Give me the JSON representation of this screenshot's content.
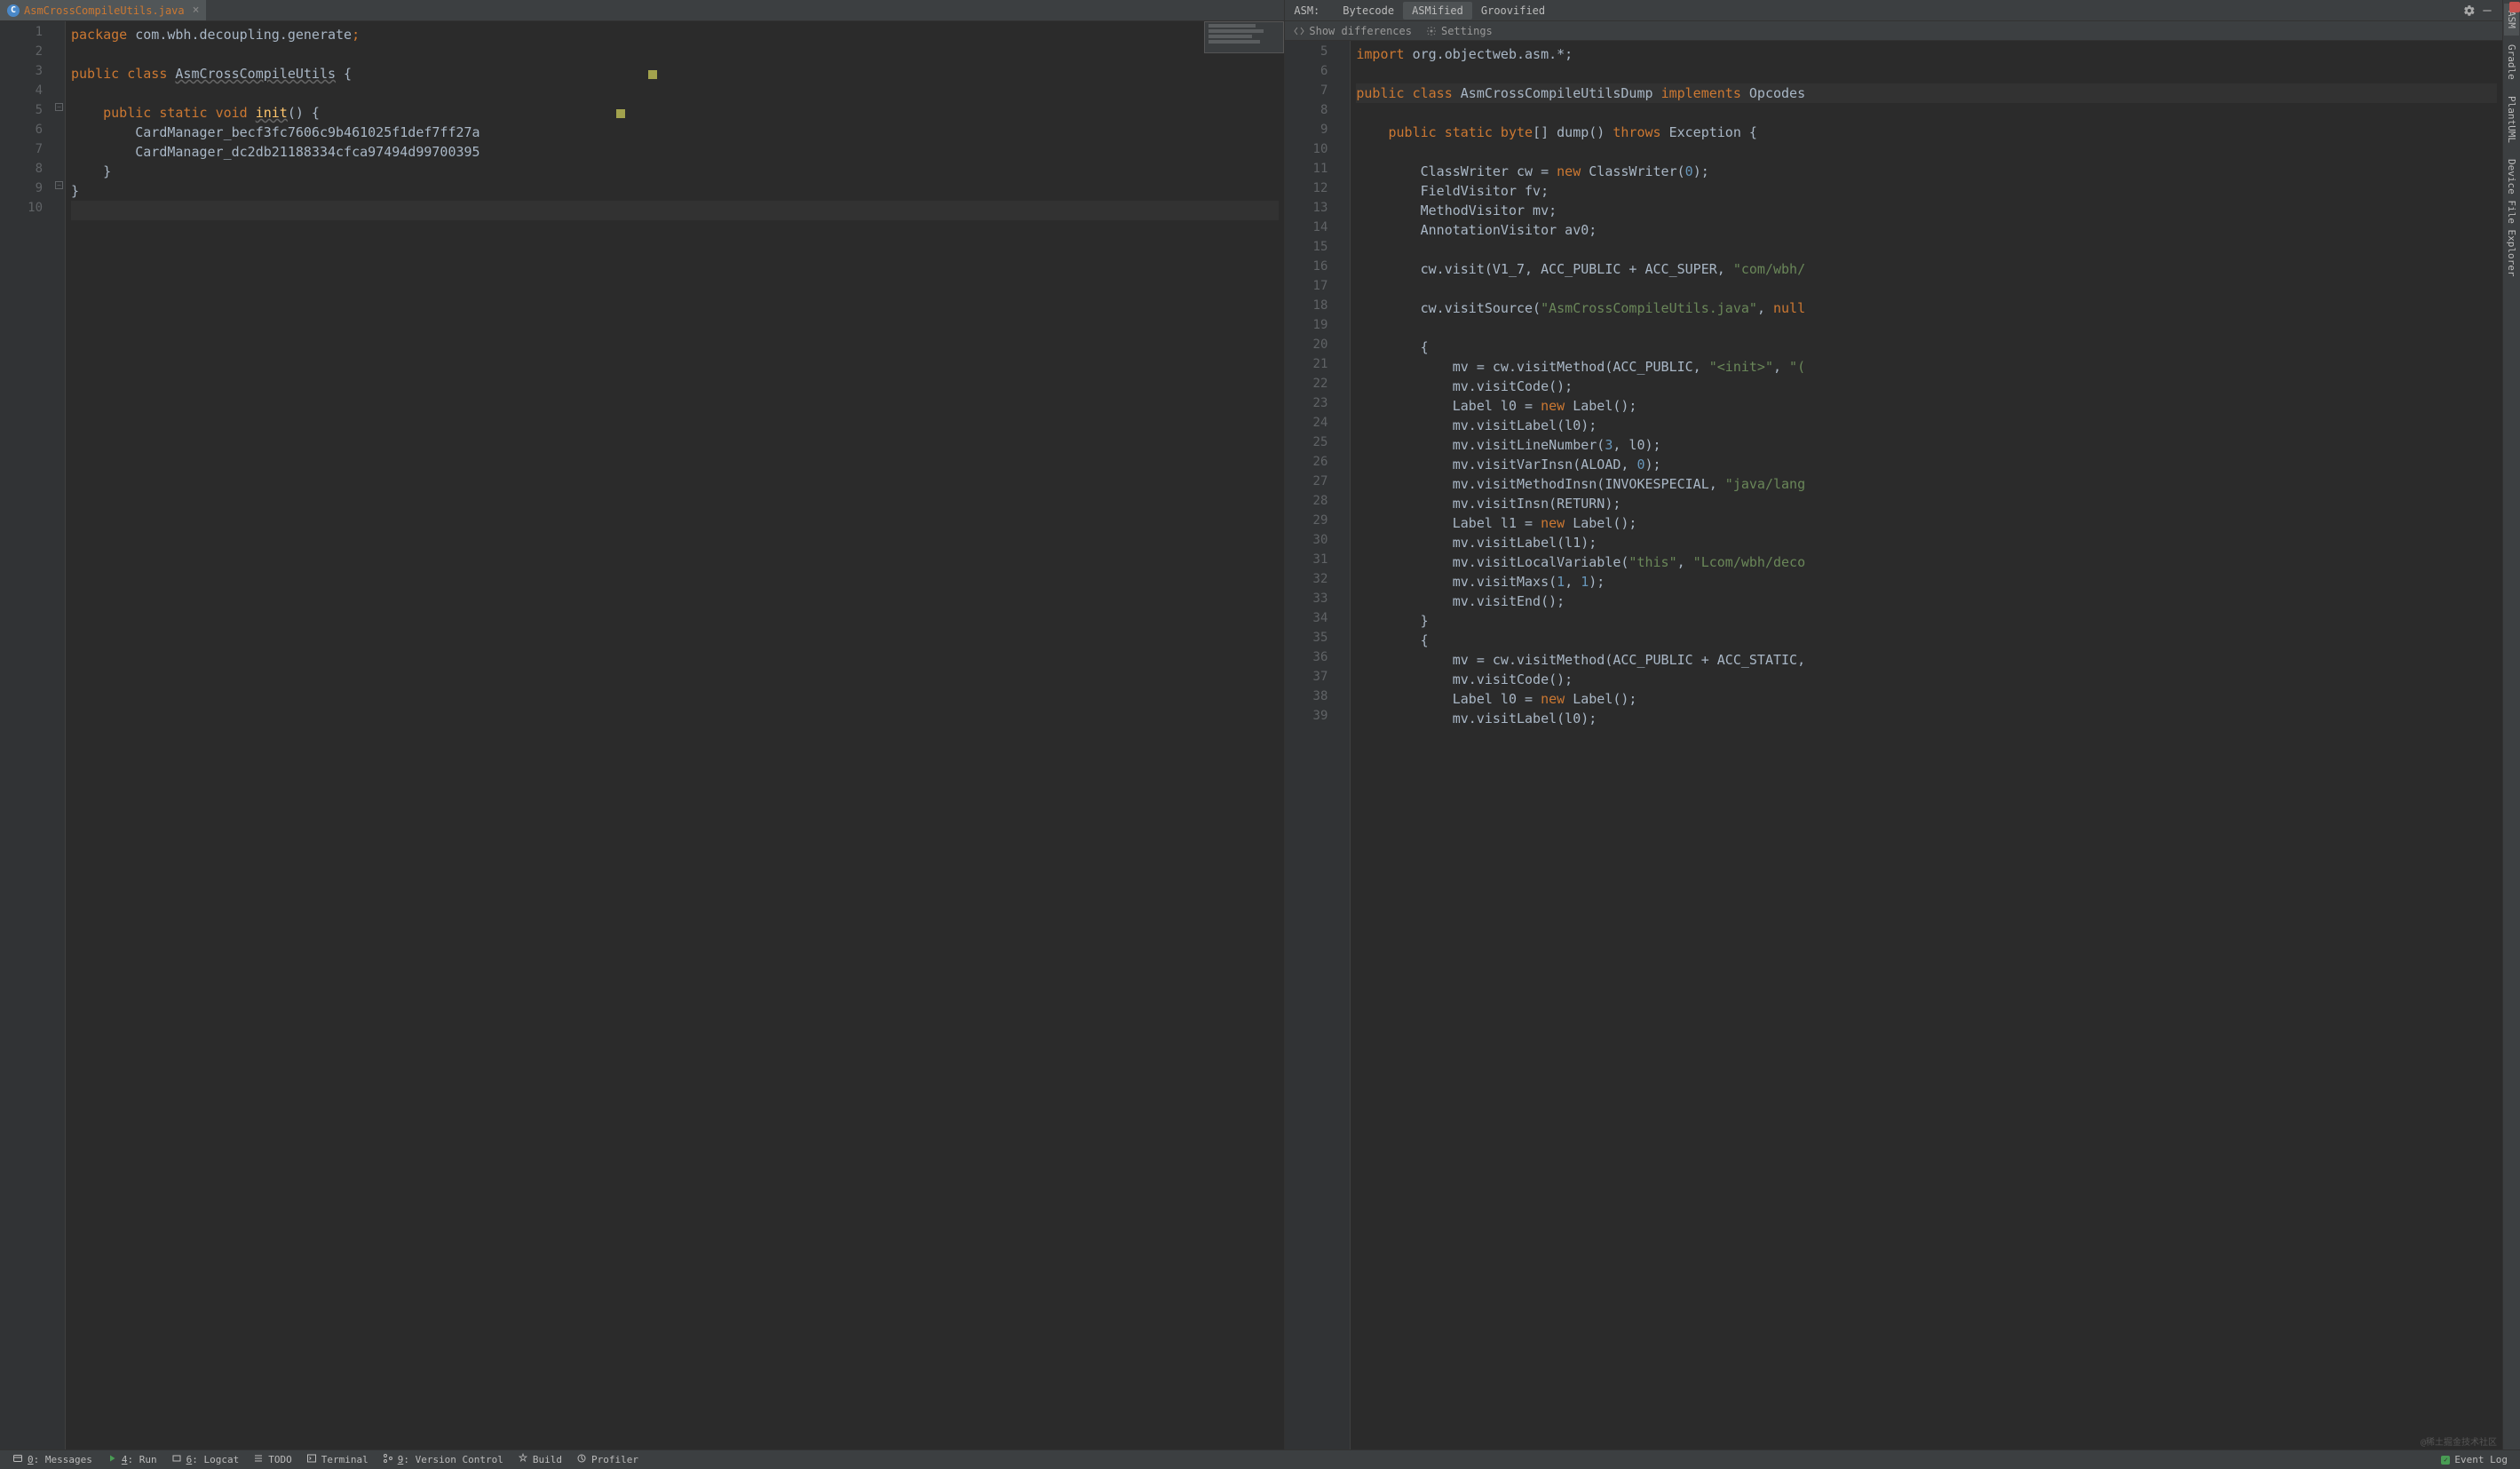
{
  "left": {
    "tab": {
      "icon_letter": "C",
      "filename": "AsmCrossCompileUtils.java"
    },
    "lines": [
      "1",
      "2",
      "3",
      "4",
      "5",
      "6",
      "7",
      "8",
      "9",
      "10"
    ],
    "code": {
      "l1": {
        "kw": "package ",
        "pkg": "com.wbh.decoupling.generate",
        "semi": ";"
      },
      "l3": {
        "kw1": "public ",
        "kw2": "class ",
        "cls": "AsmCrossCompileUtils",
        "brace": " {"
      },
      "l5": {
        "kw1": "public ",
        "kw2": "static ",
        "kw3": "void ",
        "fn": "init",
        "rest": "() {"
      },
      "l6": "CardManager_becf3fc7606c9b461025f1def7ff27a",
      "l7": "CardManager_dc2db21188334cfca97494d99700395",
      "l8": "}",
      "l9": "}"
    }
  },
  "right": {
    "header": {
      "label": "ASM:",
      "tabs": [
        "Bytecode",
        "ASMified",
        "Groovified"
      ],
      "active": 1
    },
    "toolbar": {
      "show_diff": "Show differences",
      "settings": "Settings"
    },
    "lines": [
      "5",
      "6",
      "7",
      "8",
      "9",
      "10",
      "11",
      "12",
      "13",
      "14",
      "15",
      "16",
      "17",
      "18",
      "19",
      "20",
      "21",
      "22",
      "23",
      "24",
      "25",
      "26",
      "27",
      "28",
      "29",
      "30",
      "31",
      "32",
      "33",
      "34",
      "35",
      "36",
      "37",
      "38",
      "39"
    ],
    "code": [
      {
        "indent": 0,
        "tokens": [
          {
            "c": "k-orange",
            "t": "import "
          },
          {
            "c": "",
            "t": "org.objectweb.asm.*;"
          }
        ]
      },
      {
        "indent": 0,
        "tokens": []
      },
      {
        "indent": 0,
        "tokens": [
          {
            "c": "k-orange",
            "t": "public class "
          },
          {
            "c": "",
            "t": "AsmCrossCompileUtilsDump "
          },
          {
            "c": "k-orange",
            "t": "implements "
          },
          {
            "c": "",
            "t": "Opcodes"
          }
        ]
      },
      {
        "indent": 0,
        "tokens": []
      },
      {
        "indent": 1,
        "tokens": [
          {
            "c": "k-orange",
            "t": "public static byte"
          },
          {
            "c": "",
            "t": "[] dump() "
          },
          {
            "c": "k-orange",
            "t": "throws "
          },
          {
            "c": "",
            "t": "Exception {"
          }
        ]
      },
      {
        "indent": 1,
        "tokens": []
      },
      {
        "indent": 2,
        "tokens": [
          {
            "c": "",
            "t": "ClassWriter cw = "
          },
          {
            "c": "k-orange",
            "t": "new "
          },
          {
            "c": "",
            "t": "ClassWriter("
          },
          {
            "c": "k-blue",
            "t": "0"
          },
          {
            "c": "",
            "t": ");"
          }
        ]
      },
      {
        "indent": 2,
        "tokens": [
          {
            "c": "",
            "t": "FieldVisitor fv;"
          }
        ]
      },
      {
        "indent": 2,
        "tokens": [
          {
            "c": "",
            "t": "MethodVisitor mv;"
          }
        ]
      },
      {
        "indent": 2,
        "tokens": [
          {
            "c": "",
            "t": "AnnotationVisitor av0;"
          }
        ]
      },
      {
        "indent": 2,
        "tokens": []
      },
      {
        "indent": 2,
        "tokens": [
          {
            "c": "",
            "t": "cw.visit(V1_7, ACC_PUBLIC + ACC_SUPER, "
          },
          {
            "c": "k-green",
            "t": "\"com/wbh/"
          }
        ]
      },
      {
        "indent": 2,
        "tokens": []
      },
      {
        "indent": 2,
        "tokens": [
          {
            "c": "",
            "t": "cw.visitSource("
          },
          {
            "c": "k-green",
            "t": "\"AsmCrossCompileUtils.java\""
          },
          {
            "c": "",
            "t": ", "
          },
          {
            "c": "k-orange",
            "t": "null"
          }
        ]
      },
      {
        "indent": 2,
        "tokens": []
      },
      {
        "indent": 2,
        "tokens": [
          {
            "c": "",
            "t": "{"
          }
        ]
      },
      {
        "indent": 3,
        "tokens": [
          {
            "c": "",
            "t": "mv = cw.visitMethod(ACC_PUBLIC, "
          },
          {
            "c": "k-green",
            "t": "\"<init>\""
          },
          {
            "c": "",
            "t": ", "
          },
          {
            "c": "k-green",
            "t": "\"("
          }
        ]
      },
      {
        "indent": 3,
        "tokens": [
          {
            "c": "",
            "t": "mv.visitCode();"
          }
        ]
      },
      {
        "indent": 3,
        "tokens": [
          {
            "c": "",
            "t": "Label l0 = "
          },
          {
            "c": "k-orange",
            "t": "new "
          },
          {
            "c": "",
            "t": "Label();"
          }
        ]
      },
      {
        "indent": 3,
        "tokens": [
          {
            "c": "",
            "t": "mv.visitLabel(l0);"
          }
        ]
      },
      {
        "indent": 3,
        "tokens": [
          {
            "c": "",
            "t": "mv.visitLineNumber("
          },
          {
            "c": "k-blue",
            "t": "3"
          },
          {
            "c": "",
            "t": ", l0);"
          }
        ]
      },
      {
        "indent": 3,
        "tokens": [
          {
            "c": "",
            "t": "mv.visitVarInsn(ALOAD, "
          },
          {
            "c": "k-blue",
            "t": "0"
          },
          {
            "c": "",
            "t": ");"
          }
        ]
      },
      {
        "indent": 3,
        "tokens": [
          {
            "c": "",
            "t": "mv.visitMethodInsn(INVOKESPECIAL, "
          },
          {
            "c": "k-green",
            "t": "\"java/lang"
          }
        ]
      },
      {
        "indent": 3,
        "tokens": [
          {
            "c": "",
            "t": "mv.visitInsn(RETURN);"
          }
        ]
      },
      {
        "indent": 3,
        "tokens": [
          {
            "c": "",
            "t": "Label l1 = "
          },
          {
            "c": "k-orange",
            "t": "new "
          },
          {
            "c": "",
            "t": "Label();"
          }
        ]
      },
      {
        "indent": 3,
        "tokens": [
          {
            "c": "",
            "t": "mv.visitLabel(l1);"
          }
        ]
      },
      {
        "indent": 3,
        "tokens": [
          {
            "c": "",
            "t": "mv.visitLocalVariable("
          },
          {
            "c": "k-green",
            "t": "\"this\""
          },
          {
            "c": "",
            "t": ", "
          },
          {
            "c": "k-green",
            "t": "\"Lcom/wbh/deco"
          }
        ]
      },
      {
        "indent": 3,
        "tokens": [
          {
            "c": "",
            "t": "mv.visitMaxs("
          },
          {
            "c": "k-blue",
            "t": "1"
          },
          {
            "c": "",
            "t": ", "
          },
          {
            "c": "k-blue",
            "t": "1"
          },
          {
            "c": "",
            "t": ");"
          }
        ]
      },
      {
        "indent": 3,
        "tokens": [
          {
            "c": "",
            "t": "mv.visitEnd();"
          }
        ]
      },
      {
        "indent": 2,
        "tokens": [
          {
            "c": "",
            "t": "}"
          }
        ]
      },
      {
        "indent": 2,
        "tokens": [
          {
            "c": "",
            "t": "{"
          }
        ]
      },
      {
        "indent": 3,
        "tokens": [
          {
            "c": "",
            "t": "mv = cw.visitMethod(ACC_PUBLIC + ACC_STATIC,"
          }
        ]
      },
      {
        "indent": 3,
        "tokens": [
          {
            "c": "",
            "t": "mv.visitCode();"
          }
        ]
      },
      {
        "indent": 3,
        "tokens": [
          {
            "c": "",
            "t": "Label l0 = "
          },
          {
            "c": "k-orange",
            "t": "new "
          },
          {
            "c": "",
            "t": "Label();"
          }
        ]
      },
      {
        "indent": 3,
        "tokens": [
          {
            "c": "",
            "t": "mv.visitLabel(l0);"
          }
        ]
      }
    ]
  },
  "sidebar": [
    "ASM",
    "Gradle",
    "PlantUML",
    "Device File Explorer"
  ],
  "footer": {
    "items": [
      {
        "icon": "msg",
        "label": "0: Messages",
        "u": "0"
      },
      {
        "icon": "play",
        "label": "4: Run",
        "u": "4"
      },
      {
        "icon": "logcat",
        "label": "6: Logcat",
        "u": "6"
      },
      {
        "icon": "todo",
        "label": "TODO",
        "u": ""
      },
      {
        "icon": "term",
        "label": "Terminal",
        "u": ""
      },
      {
        "icon": "vcs",
        "label": "9: Version Control",
        "u": "9"
      },
      {
        "icon": "build",
        "label": "Build",
        "u": ""
      },
      {
        "icon": "profiler",
        "label": "Profiler",
        "u": ""
      }
    ],
    "event_log": "Event Log"
  },
  "watermark": "@稀土掘金技术社区"
}
